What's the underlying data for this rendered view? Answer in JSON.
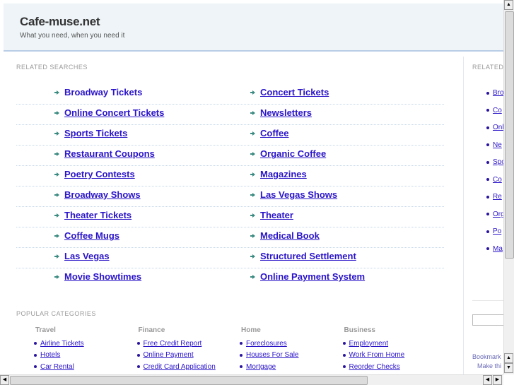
{
  "header": {
    "title": "Cafe-muse.net",
    "tagline": "What you need, when you need it"
  },
  "related": {
    "label": "RELATED SEARCHES",
    "left": [
      "Broadway Tickets",
      "Online Concert Tickets",
      "Sports Tickets",
      "Restaurant Coupons",
      "Poetry Contests",
      "Broadway Shows",
      "Theater Tickets",
      "Coffee Mugs",
      "Las Vegas",
      "Movie Showtimes"
    ],
    "right": [
      "Concert Tickets",
      "Newsletters",
      "Coffee",
      "Organic Coffee",
      "Magazines",
      "Las Vegas Shows",
      "Theater",
      "Medical Book",
      "Structured Settlement",
      "Online Payment System"
    ]
  },
  "popular": {
    "label": "POPULAR CATEGORIES",
    "categories": [
      {
        "title": "Travel",
        "items": [
          "Airline Tickets",
          "Hotels",
          "Car Rental"
        ]
      },
      {
        "title": "Finance",
        "items": [
          "Free Credit Report",
          "Online Payment",
          "Credit Card Application"
        ]
      },
      {
        "title": "Home",
        "items": [
          "Foreclosures",
          "Houses For Sale",
          "Mortgage"
        ]
      },
      {
        "title": "Business",
        "items": [
          "Employment",
          "Work From Home",
          "Reorder Checks"
        ]
      }
    ]
  },
  "sidebar": {
    "label": "RELATED",
    "items": [
      "Bro",
      "Co",
      "Onl",
      "Ne",
      "Spo",
      "Co",
      "Re",
      "Org",
      "Po",
      "Ma"
    ],
    "bookmark": "Bookmark",
    "make": "Make thi"
  },
  "colors": {
    "link": "#2a14c8",
    "arrow": "#3a8a80",
    "header_bg": "#eef4f7"
  }
}
